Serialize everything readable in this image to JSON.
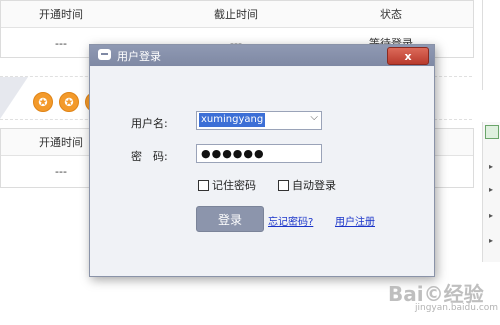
{
  "background": {
    "top_table": {
      "headers": [
        "开通时间",
        "截止时间",
        "状态"
      ],
      "row": [
        "---",
        "---",
        "等待登录"
      ]
    },
    "bottom_table": {
      "headers": [
        "开通时间"
      ],
      "row": [
        "---"
      ]
    },
    "stars": [
      "✪",
      "✪",
      "✪"
    ]
  },
  "dialog": {
    "title": "用户登录",
    "close_label": "x",
    "username_label": "用户名:",
    "username_value": "xumingyang",
    "password_label": "密　码:",
    "password_mask": "●●●●●●",
    "remember_label": "记住密码",
    "auto_login_label": "自动登录",
    "login_button": "登录",
    "forgot_link": "忘记密码?",
    "register_link": "用户注册"
  },
  "watermark": {
    "text": "Bai©经验",
    "sub": "jingyan.baidu.com"
  }
}
